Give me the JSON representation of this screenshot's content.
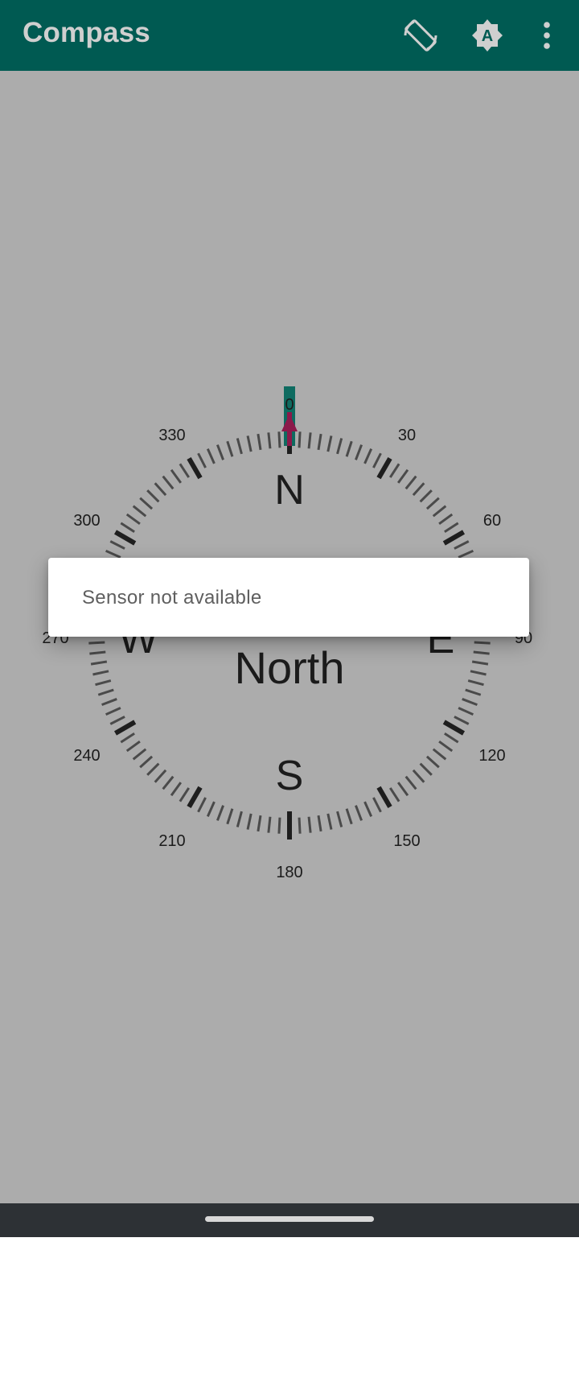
{
  "app": {
    "title": "Compass"
  },
  "toolbar": {
    "actions": [
      {
        "icon": "screen-rotation-icon"
      },
      {
        "icon": "auto-brightness-icon",
        "glyph": "A"
      },
      {
        "icon": "more-vert-icon"
      }
    ]
  },
  "compass": {
    "heading_text": "North",
    "cardinals": {
      "north": "N",
      "east": "E",
      "south": "S",
      "west": "W"
    },
    "degree_labels": [
      "0",
      "30",
      "60",
      "90",
      "120",
      "150",
      "180",
      "210",
      "240",
      "270",
      "300",
      "330"
    ],
    "needle_heading_degrees": 0,
    "colors": {
      "needle": "#8b1a4a",
      "marker": "#0e6b60",
      "ticks": "#4a4a4a",
      "major_ticks": "#1e1e1e"
    }
  },
  "dialog": {
    "message": "Sensor not available"
  },
  "colors": {
    "appbar": "#005a52",
    "background": "#acacac",
    "navbar": "#2d3135"
  }
}
